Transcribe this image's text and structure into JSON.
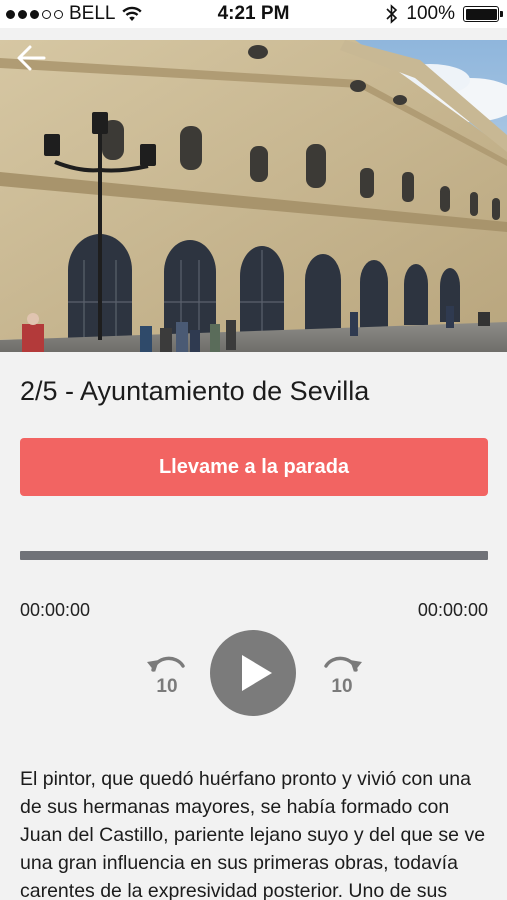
{
  "status_bar": {
    "carrier": "BELL",
    "time": "4:21 PM",
    "battery": "100%",
    "signal_icon": "signal-dots-icon",
    "wifi_icon": "wifi-icon",
    "bluetooth_icon": "bluetooth-icon",
    "battery_icon": "battery-icon"
  },
  "header": {
    "back_icon": "arrow-left-icon"
  },
  "stop": {
    "title": "2/5 - Ayuntamiento de Sevilla",
    "cta_label": "Llevame a la parada"
  },
  "player": {
    "progress": 0,
    "elapsed": "00:00:00",
    "duration": "00:00:00",
    "rewind_label": "10",
    "forward_label": "10",
    "rewind_icon": "rewind-10-icon",
    "play_icon": "play-icon",
    "forward_icon": "forward-10-icon"
  },
  "description": "El pintor, que quedó huérfano pronto y vivió con una de sus hermanas mayores, se había formado con Juan del Castillo, pariente lejano suyo y del que se ve una gran influencia en sus primeras obras, todavía carentes de la expresividad posterior. Uno de sus primeros",
  "colors": {
    "accent": "#f26462",
    "progress_track": "#707278",
    "play_button": "#7b7b7b",
    "background": "#f2f2f2"
  }
}
